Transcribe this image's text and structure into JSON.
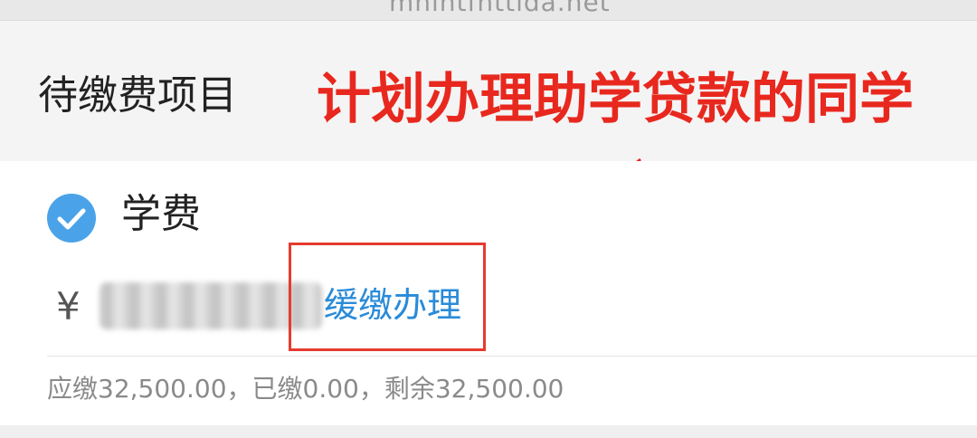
{
  "topbar": {
    "text": "mhlhtfhttlda.net"
  },
  "section": {
    "title": "待缴费项目"
  },
  "annotation": {
    "text": "计划办理助学贷款的同学"
  },
  "item": {
    "name": "学费",
    "currency_symbol": "¥",
    "amount_redacted": "32,500.00",
    "defer_label": "缓缴办理",
    "summary": "应缴32,500.00，已缴0.00，剩余32,500.00"
  },
  "colors": {
    "accent_blue": "#2a8bd8",
    "check_blue": "#4aa3e8",
    "annotation_red": "#e8281e"
  },
  "icons": {
    "check": "check-circle-icon",
    "arrow": "annotation-arrow"
  }
}
